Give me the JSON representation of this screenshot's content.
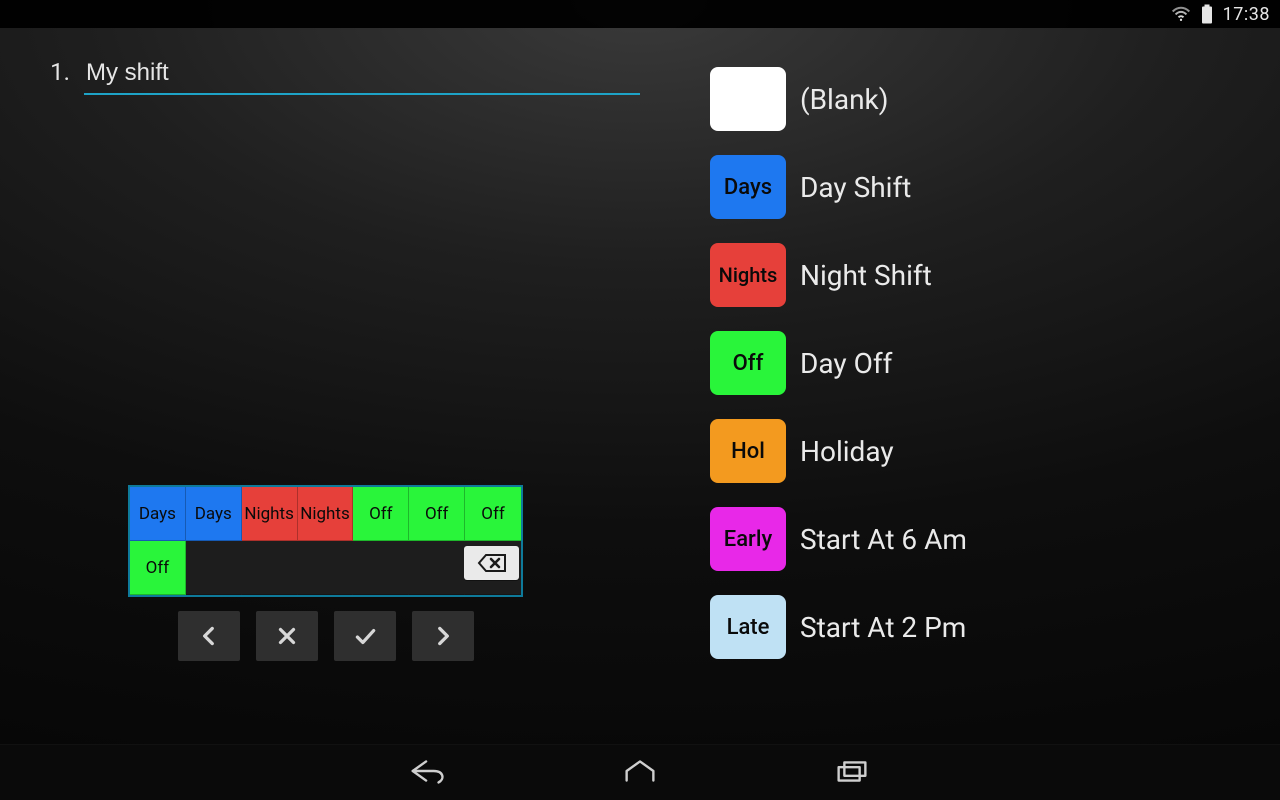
{
  "statusbar": {
    "time": "17:38"
  },
  "pattern": {
    "index": "1.",
    "name": "My shift",
    "sequence": [
      {
        "tag": "Days",
        "color_class": "c-blue"
      },
      {
        "tag": "Days",
        "color_class": "c-blue"
      },
      {
        "tag": "Nights",
        "color_class": "c-red"
      },
      {
        "tag": "Nights",
        "color_class": "c-red"
      },
      {
        "tag": "Off",
        "color_class": "c-green"
      },
      {
        "tag": "Off",
        "color_class": "c-green"
      },
      {
        "tag": "Off",
        "color_class": "c-green"
      },
      {
        "tag": "Off",
        "color_class": "c-green"
      }
    ],
    "grid_cols": 7
  },
  "palette": [
    {
      "tag": "",
      "label": "(Blank)",
      "color_class": "c-white"
    },
    {
      "tag": "Days",
      "label": "Day Shift",
      "color_class": "c-blue"
    },
    {
      "tag": "Nights",
      "label": "Night Shift",
      "color_class": "c-red"
    },
    {
      "tag": "Off",
      "label": "Day Off",
      "color_class": "c-green"
    },
    {
      "tag": "Hol",
      "label": "Holiday",
      "color_class": "c-orange"
    },
    {
      "tag": "Early",
      "label": "Start At 6 Am",
      "color_class": "c-magenta"
    },
    {
      "tag": "Late",
      "label": "Start At 2 Pm",
      "color_class": "c-ltblue"
    }
  ]
}
